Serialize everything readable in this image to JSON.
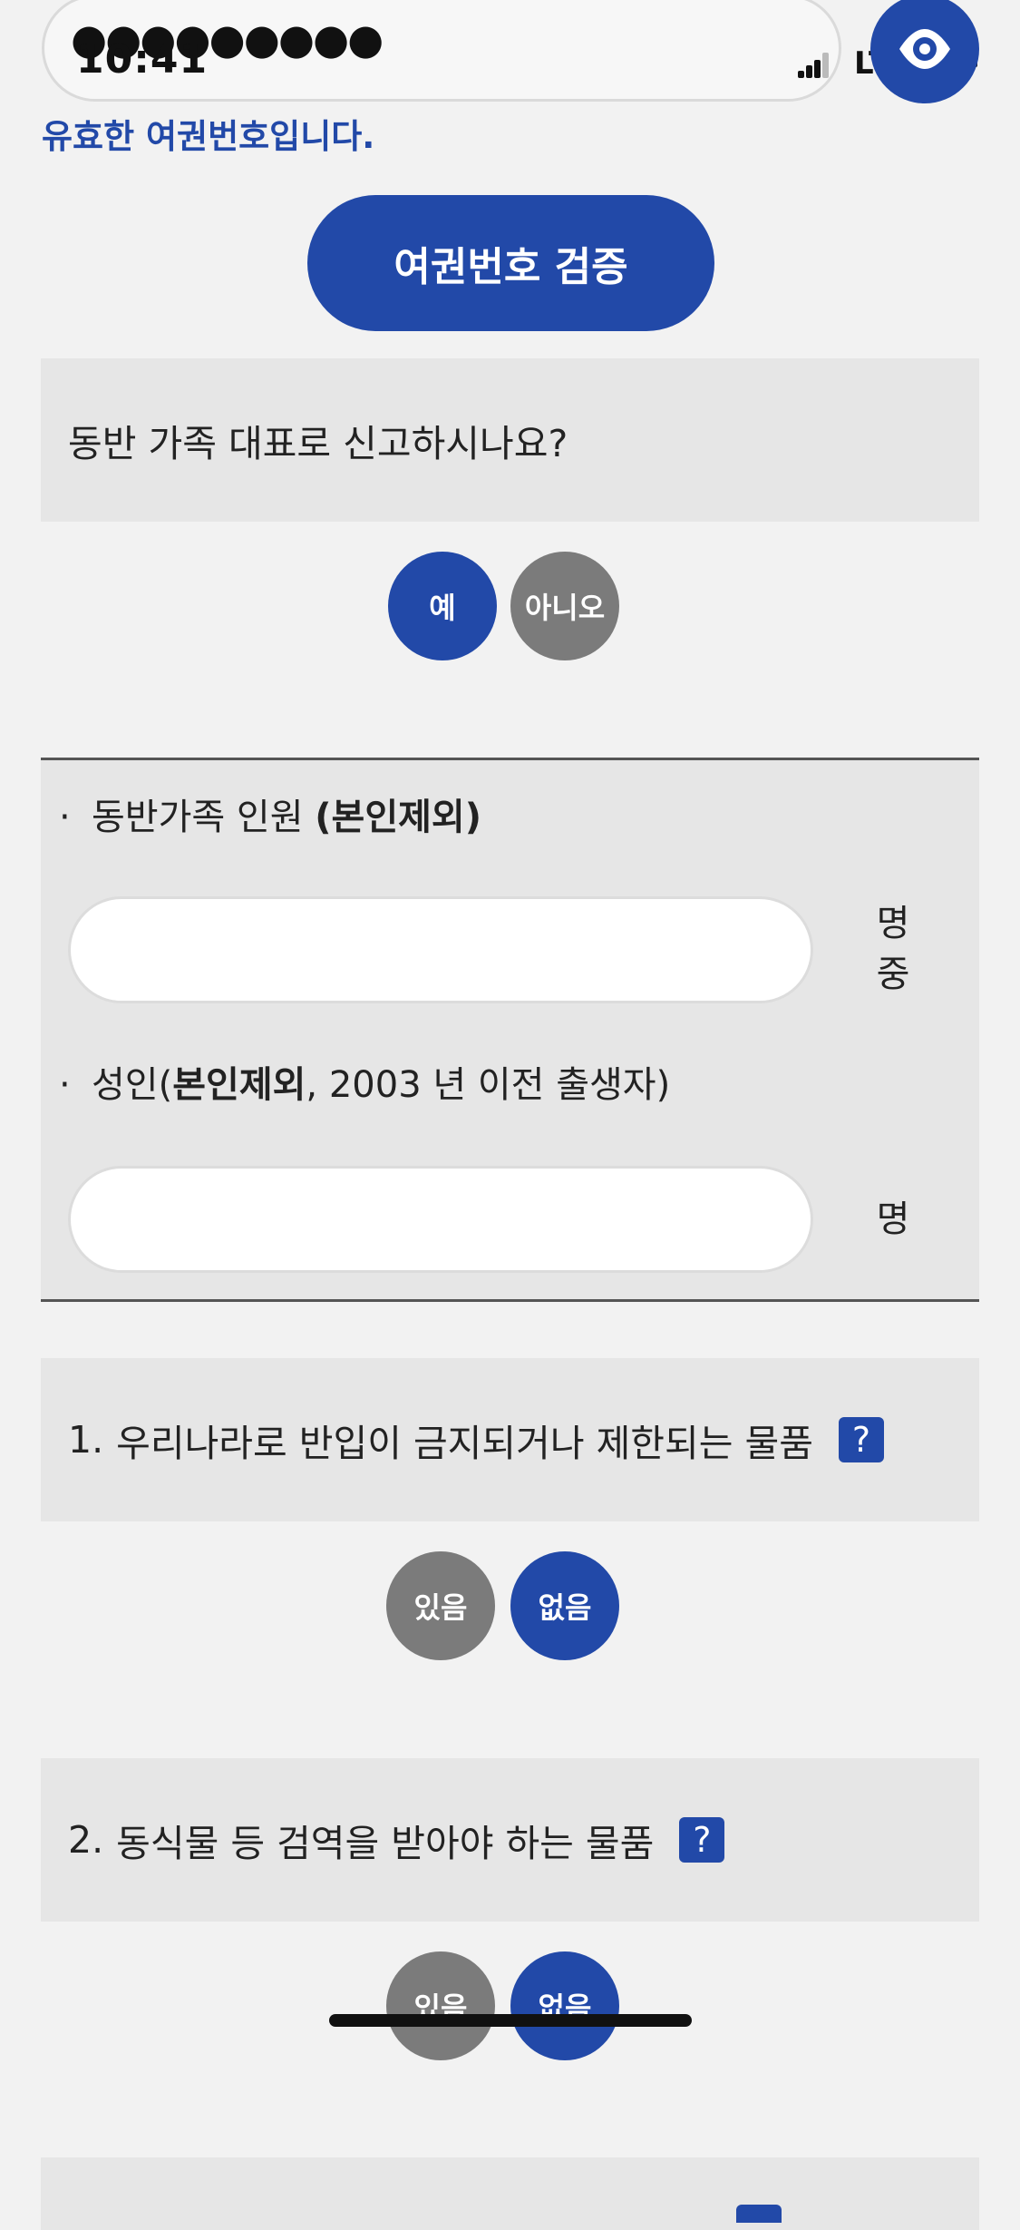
{
  "status_bar": {
    "time": "10:41",
    "network": "LTE"
  },
  "password": {
    "masked_value": "●●●●●●●●●"
  },
  "validation_message": "유효한 여권번호입니다.",
  "verify_button": "여권번호 검증",
  "rep_question": {
    "text": "동반 가족 대표로 신고하시나요?",
    "yes": "예",
    "no": "아니오",
    "selected": "예"
  },
  "family": {
    "companions_label_prefix": "동반가족 인원 ",
    "companions_label_bold": "(본인제외)",
    "companions_value": "",
    "companions_unit": "명",
    "companions_unit_suffix": "중",
    "adults_label_prefix": "성인(",
    "adults_label_bold": "본인제외",
    "adults_label_suffix": ", 2003 년 이전 출생자)",
    "adults_value": "",
    "adults_unit": "명"
  },
  "questions": [
    {
      "number": "1.",
      "text": "우리나라로 반입이 금지되거나 제한되는 물품",
      "help": "?",
      "have": "있음",
      "none": "없음",
      "selected": "없음"
    },
    {
      "number": "2.",
      "text": "동식물 등 검역을 받아야 하는 물품",
      "help": "?",
      "have": "있음",
      "none": "없음",
      "selected": "없음"
    }
  ],
  "colors": {
    "primary": "#2249a8",
    "unselected": "#7b7b7b",
    "panel": "#e6e6e6",
    "background": "#f2f2f2"
  },
  "icons": {
    "eye": "eye-icon",
    "help": "help-icon"
  }
}
